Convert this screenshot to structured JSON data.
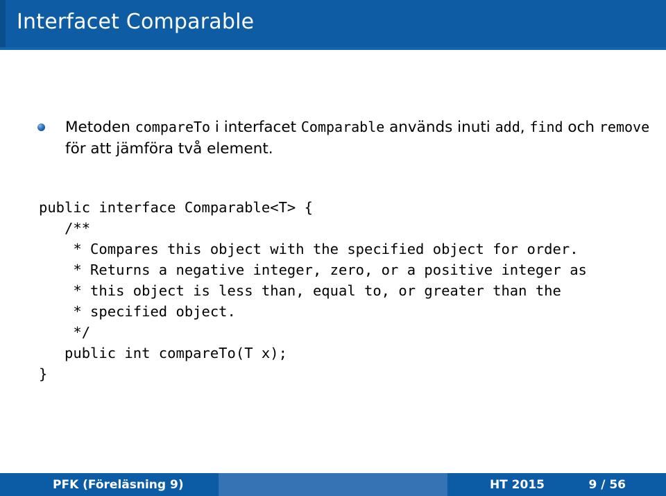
{
  "slide": {
    "title": "Interfacet Comparable",
    "theme_colors": {
      "header_blue": "#0d5ca4",
      "header_left_strip": "#0a4e8c",
      "footer_dark": "#0b5ba5",
      "footer_light": "#3673b4",
      "bullet_blue": "#1355a0",
      "text_black": "#000000",
      "background": "#ffffff"
    }
  },
  "bullet": {
    "marker_icon": "blue-sphere-bullet-icon",
    "parts": [
      {
        "text": "Metoden ",
        "style": "text"
      },
      {
        "text": "compareTo",
        "style": "mono"
      },
      {
        "text": " i interfacet ",
        "style": "text"
      },
      {
        "text": "Comparable",
        "style": "mono"
      },
      {
        "text": " används inuti ",
        "style": "text"
      },
      {
        "text": "add",
        "style": "mono"
      },
      {
        "text": ", ",
        "style": "text"
      },
      {
        "text": "find",
        "style": "mono"
      },
      {
        "text": " och ",
        "style": "text"
      },
      {
        "text": "remove",
        "style": "mono"
      },
      {
        "text": " för att jämföra två element.",
        "style": "text"
      }
    ],
    "plain_text": "Metoden compareTo i interfacet Comparable används inuti add, find och remove för att jämföra två element."
  },
  "code": {
    "language": "java",
    "lines": [
      "public interface Comparable<T> {",
      "   /**",
      "    * Compares this object with the specified object for order.",
      "    * Returns a negative integer, zero, or a positive integer as",
      "    * this object is less than, equal to, or greater than the",
      "    * specified object.",
      "    */",
      "   public int compareTo(T x);",
      "}"
    ]
  },
  "footer": {
    "author": "PFK  (Föreläsning 9)",
    "term": "HT 2015",
    "page": "9 / 56"
  }
}
